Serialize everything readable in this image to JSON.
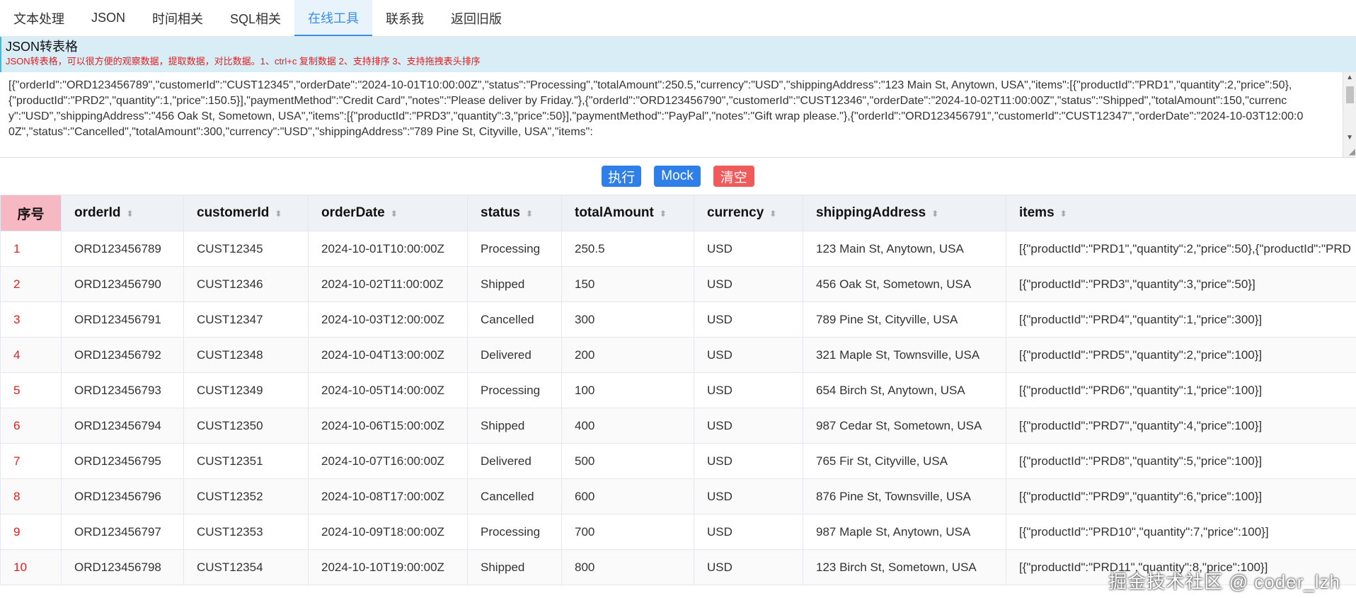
{
  "nav": {
    "items": [
      {
        "label": "文本处理",
        "active": false
      },
      {
        "label": "JSON",
        "active": false
      },
      {
        "label": "时间相关",
        "active": false
      },
      {
        "label": "SQL相关",
        "active": false
      },
      {
        "label": "在线工具",
        "active": true
      },
      {
        "label": "联系我",
        "active": false
      },
      {
        "label": "返回旧版",
        "active": false
      }
    ]
  },
  "banner": {
    "title": "JSON转表格",
    "desc": "JSON转表格，可以很方便的观察数据，提取数据，对比数据。1、ctrl+c 复制数据 2、支持排序 3、支持拖拽表头排序"
  },
  "editor": {
    "value": "[{\"orderId\":\"ORD123456789\",\"customerId\":\"CUST12345\",\"orderDate\":\"2024-10-01T10:00:00Z\",\"status\":\"Processing\",\"totalAmount\":250.5,\"currency\":\"USD\",\"shippingAddress\":\"123 Main St, Anytown, USA\",\"items\":[{\"productId\":\"PRD1\",\"quantity\":2,\"price\":50},{\"productId\":\"PRD2\",\"quantity\":1,\"price\":150.5}],\"paymentMethod\":\"Credit Card\",\"notes\":\"Please deliver by Friday.\"},{\"orderId\":\"ORD123456790\",\"customerId\":\"CUST12346\",\"orderDate\":\"2024-10-02T11:00:00Z\",\"status\":\"Shipped\",\"totalAmount\":150,\"currency\":\"USD\",\"shippingAddress\":\"456 Oak St, Sometown, USA\",\"items\":[{\"productId\":\"PRD3\",\"quantity\":3,\"price\":50}],\"paymentMethod\":\"PayPal\",\"notes\":\"Gift wrap please.\"},{\"orderId\":\"ORD123456791\",\"customerId\":\"CUST12347\",\"orderDate\":\"2024-10-03T12:00:00Z\",\"status\":\"Cancelled\",\"totalAmount\":300,\"currency\":\"USD\",\"shippingAddress\":\"789 Pine St, Cityville, USA\",\"items\":"
  },
  "buttons": {
    "run": "执行",
    "mock": "Mock",
    "clear": "清空"
  },
  "table": {
    "columns": [
      "序号",
      "orderId",
      "customerId",
      "orderDate",
      "status",
      "totalAmount",
      "currency",
      "shippingAddress",
      "items"
    ],
    "rows": [
      [
        "1",
        "ORD123456789",
        "CUST12345",
        "2024-10-01T10:00:00Z",
        "Processing",
        "250.5",
        "USD",
        "123 Main St, Anytown, USA",
        "[{\"productId\":\"PRD1\",\"quantity\":2,\"price\":50},{\"productId\":\"PRD"
      ],
      [
        "2",
        "ORD123456790",
        "CUST12346",
        "2024-10-02T11:00:00Z",
        "Shipped",
        "150",
        "USD",
        "456 Oak St, Sometown, USA",
        "[{\"productId\":\"PRD3\",\"quantity\":3,\"price\":50}]"
      ],
      [
        "3",
        "ORD123456791",
        "CUST12347",
        "2024-10-03T12:00:00Z",
        "Cancelled",
        "300",
        "USD",
        "789 Pine St, Cityville, USA",
        "[{\"productId\":\"PRD4\",\"quantity\":1,\"price\":300}]"
      ],
      [
        "4",
        "ORD123456792",
        "CUST12348",
        "2024-10-04T13:00:00Z",
        "Delivered",
        "200",
        "USD",
        "321 Maple St, Townsville, USA",
        "[{\"productId\":\"PRD5\",\"quantity\":2,\"price\":100}]"
      ],
      [
        "5",
        "ORD123456793",
        "CUST12349",
        "2024-10-05T14:00:00Z",
        "Processing",
        "100",
        "USD",
        "654 Birch St, Anytown, USA",
        "[{\"productId\":\"PRD6\",\"quantity\":1,\"price\":100}]"
      ],
      [
        "6",
        "ORD123456794",
        "CUST12350",
        "2024-10-06T15:00:00Z",
        "Shipped",
        "400",
        "USD",
        "987 Cedar St, Sometown, USA",
        "[{\"productId\":\"PRD7\",\"quantity\":4,\"price\":100}]"
      ],
      [
        "7",
        "ORD123456795",
        "CUST12351",
        "2024-10-07T16:00:00Z",
        "Delivered",
        "500",
        "USD",
        "765 Fir St, Cityville, USA",
        "[{\"productId\":\"PRD8\",\"quantity\":5,\"price\":100}]"
      ],
      [
        "8",
        "ORD123456796",
        "CUST12352",
        "2024-10-08T17:00:00Z",
        "Cancelled",
        "600",
        "USD",
        "876 Pine St, Townsville, USA",
        "[{\"productId\":\"PRD9\",\"quantity\":6,\"price\":100}]"
      ],
      [
        "9",
        "ORD123456797",
        "CUST12353",
        "2024-10-09T18:00:00Z",
        "Processing",
        "700",
        "USD",
        "987 Maple St, Anytown, USA",
        "[{\"productId\":\"PRD10\",\"quantity\":7,\"price\":100}]"
      ],
      [
        "10",
        "ORD123456798",
        "CUST12354",
        "2024-10-10T19:00:00Z",
        "Shipped",
        "800",
        "USD",
        "123 Birch St, Sometown, USA",
        "[{\"productId\":\"PRD11\",\"quantity\":8,\"price\":100}]"
      ]
    ]
  },
  "watermark": "掘金技术社区 @ coder_lzh",
  "icons": {
    "sort": "sort-caret-icon",
    "scroll_up": "scroll-up-arrow-icon",
    "scroll_down": "scroll-down-arrow-icon",
    "resize": "resize-grip-icon"
  },
  "colors": {
    "accent": "#2f7fe8",
    "danger": "#ef5b5b",
    "index_header": "#f6b9c3",
    "banner_bg": "#d9edf7",
    "index_text": "#e02020"
  }
}
